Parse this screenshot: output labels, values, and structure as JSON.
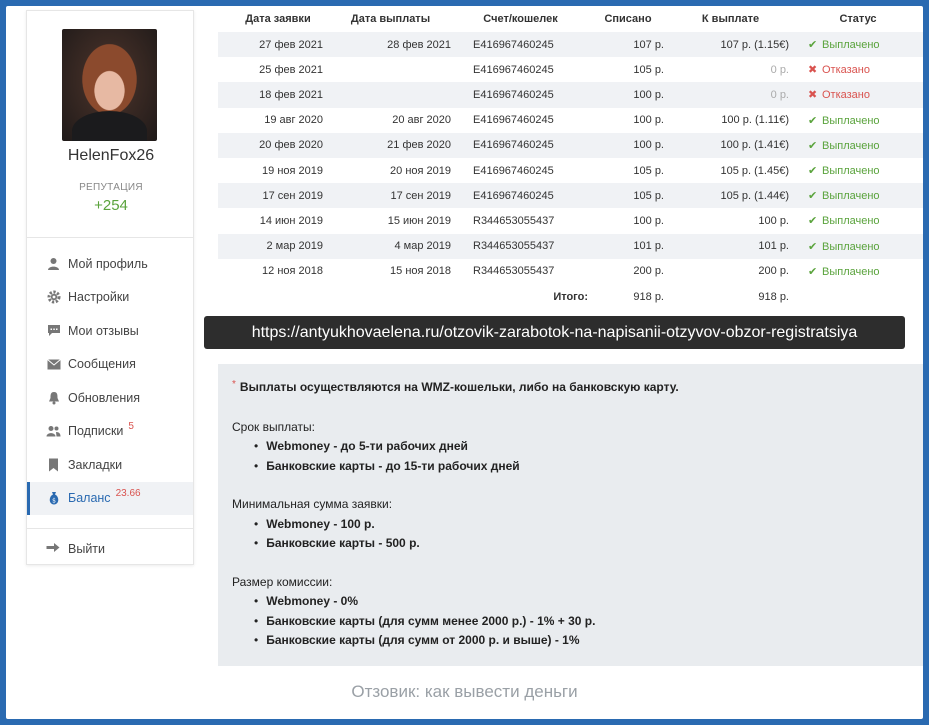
{
  "profile": {
    "username": "HelenFox26",
    "reputation_label": "РЕПУТАЦИЯ",
    "reputation_value": "+254"
  },
  "menu": {
    "items": [
      {
        "label": "Мой профиль",
        "icon": "user-icon"
      },
      {
        "label": "Настройки",
        "icon": "gear-icon"
      },
      {
        "label": "Мои отзывы",
        "icon": "comment-icon"
      },
      {
        "label": "Сообщения",
        "icon": "envelope-icon"
      },
      {
        "label": "Обновления",
        "icon": "bell-icon"
      },
      {
        "label": "Подписки",
        "icon": "users-icon",
        "badge": "5"
      },
      {
        "label": "Закладки",
        "icon": "bookmark-icon"
      },
      {
        "label": "Баланс",
        "icon": "money-bag-icon",
        "badge": "23.66",
        "active": true
      }
    ],
    "logout_label": "Выйти"
  },
  "table": {
    "headers": [
      "Дата заявки",
      "Дата выплаты",
      "Счет/кошелек",
      "Списано",
      "К выплате",
      "Статус"
    ],
    "rows": [
      {
        "request_date": "27 фев 2021",
        "payout_date": "28 фев 2021",
        "wallet": "E416967460245",
        "charged": "107 р.",
        "payout": "107 р. (1.15€)",
        "status": "Выплачено",
        "ok": true
      },
      {
        "request_date": "25 фев 2021",
        "payout_date": "",
        "wallet": "E416967460245",
        "charged": "105 р.",
        "payout": "0 р.",
        "status": "Отказано",
        "ok": false
      },
      {
        "request_date": "18 фев 2021",
        "payout_date": "",
        "wallet": "E416967460245",
        "charged": "100 р.",
        "payout": "0 р.",
        "status": "Отказано",
        "ok": false
      },
      {
        "request_date": "19 авг 2020",
        "payout_date": "20 авг 2020",
        "wallet": "E416967460245",
        "charged": "100 р.",
        "payout": "100 р. (1.11€)",
        "status": "Выплачено",
        "ok": true
      },
      {
        "request_date": "20 фев 2020",
        "payout_date": "21 фев 2020",
        "wallet": "E416967460245",
        "charged": "100 р.",
        "payout": "100 р. (1.41€)",
        "status": "Выплачено",
        "ok": true
      },
      {
        "request_date": "19 ноя 2019",
        "payout_date": "20 ноя 2019",
        "wallet": "E416967460245",
        "charged": "105 р.",
        "payout": "105 р. (1.45€)",
        "status": "Выплачено",
        "ok": true
      },
      {
        "request_date": "17 сен 2019",
        "payout_date": "17 сен 2019",
        "wallet": "E416967460245",
        "charged": "105 р.",
        "payout": "105 р. (1.44€)",
        "status": "Выплачено",
        "ok": true
      },
      {
        "request_date": "14 июн 2019",
        "payout_date": "15 июн 2019",
        "wallet": "R344653055437",
        "charged": "100 р.",
        "payout": "100 р.",
        "status": "Выплачено",
        "ok": true
      },
      {
        "request_date": "2 мар 2019",
        "payout_date": "4 мар 2019",
        "wallet": "R344653055437",
        "charged": "101 р.",
        "payout": "101 р.",
        "status": "Выплачено",
        "ok": true
      },
      {
        "request_date": "12 ноя 2018",
        "payout_date": "15 ноя 2018",
        "wallet": "R344653055437",
        "charged": "200 р.",
        "payout": "200 р.",
        "status": "Выплачено",
        "ok": true
      }
    ],
    "total_label": "Итого:",
    "total_charged": "918 р.",
    "total_payout": "918 р."
  },
  "overlay_url": "https://antyukhovaelena.ru/otzovik-zarabotok-na-napisanii-otzyvov-obzor-registratsiya",
  "info": {
    "intro": "Выплаты осуществляются на WMZ-кошельки, либо на банковскую карту.",
    "term_heading": "Срок выплаты:",
    "term_items": [
      "Webmoney - до 5-ти рабочих дней",
      "Банковские карты - до 15-ти рабочих дней"
    ],
    "min_heading": "Минимальная сумма заявки:",
    "min_items": [
      "Webmoney - 100 р.",
      "Банковские карты - 500 р."
    ],
    "fee_heading": "Размер комиссии:",
    "fee_items": [
      "Webmoney - 0%",
      "Банковские карты (для сумм менее 2000 р.) - 1% + 30 р.",
      "Банковские карты (для сумм от 2000 р. и выше) - 1%"
    ]
  },
  "caption": "Отзовик: как вывести деньги",
  "colors": {
    "accent": "#2a6ab1",
    "ok": "#5aa33c",
    "error": "#d9534f"
  }
}
